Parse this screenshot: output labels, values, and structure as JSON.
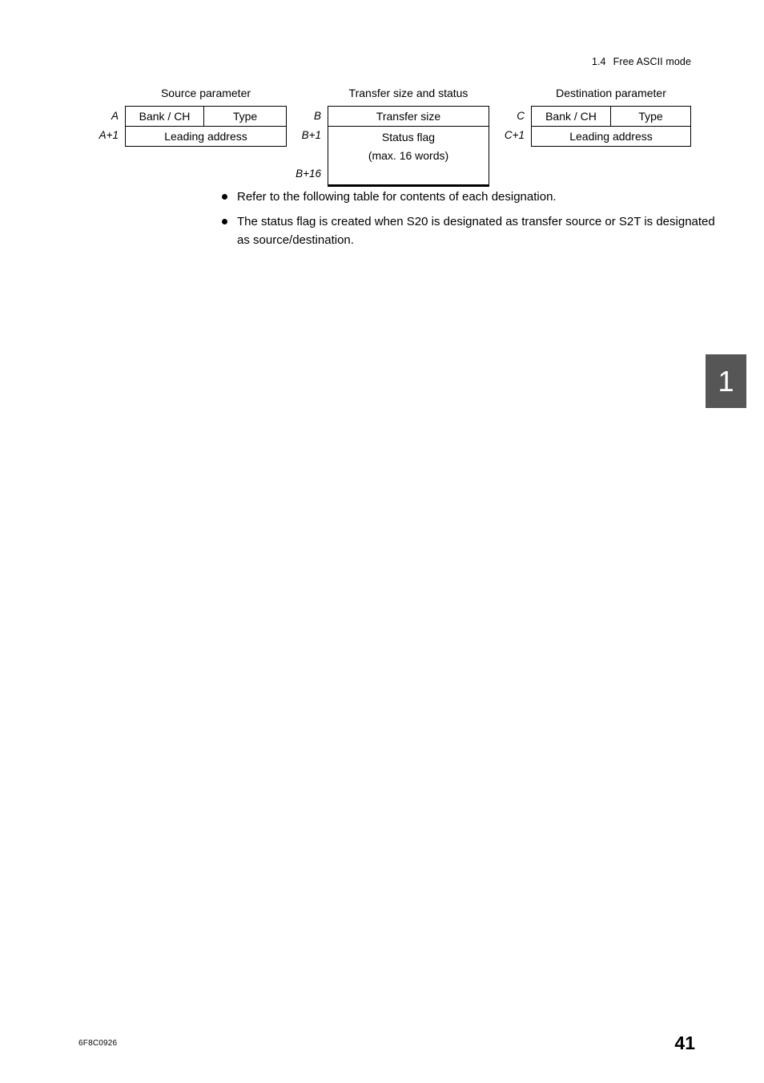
{
  "header": {
    "section_number": "1.4",
    "section_title": "Free ASCII mode"
  },
  "diagram": {
    "blocks": [
      {
        "title": "Source parameter",
        "row_labels": [
          "A",
          "A+1"
        ],
        "rows": [
          {
            "cells": [
              "Bank / CH",
              "Type"
            ]
          },
          {
            "cells": [
              "Leading address"
            ]
          }
        ]
      },
      {
        "title": "Transfer size and status",
        "row_labels": [
          "B",
          "B+1",
          "B+16"
        ],
        "rows": [
          {
            "cells": [
              "Transfer size"
            ]
          },
          {
            "cells": [
              "Status flag"
            ],
            "sub": "(max. 16 words)"
          }
        ]
      },
      {
        "title": "Destination parameter",
        "row_labels": [
          "C",
          "C+1"
        ],
        "rows": [
          {
            "cells": [
              "Bank / CH",
              "Type"
            ]
          },
          {
            "cells": [
              "Leading address"
            ]
          }
        ]
      }
    ]
  },
  "notes": [
    "Refer to the following table for contents of each designation.",
    "The status flag is created when S20 is designated as transfer source or S2T is designated as source/destination."
  ],
  "chapter_tab": {
    "number": "1"
  },
  "footer": {
    "document_code": "6F8C0926",
    "page_number": "41"
  }
}
